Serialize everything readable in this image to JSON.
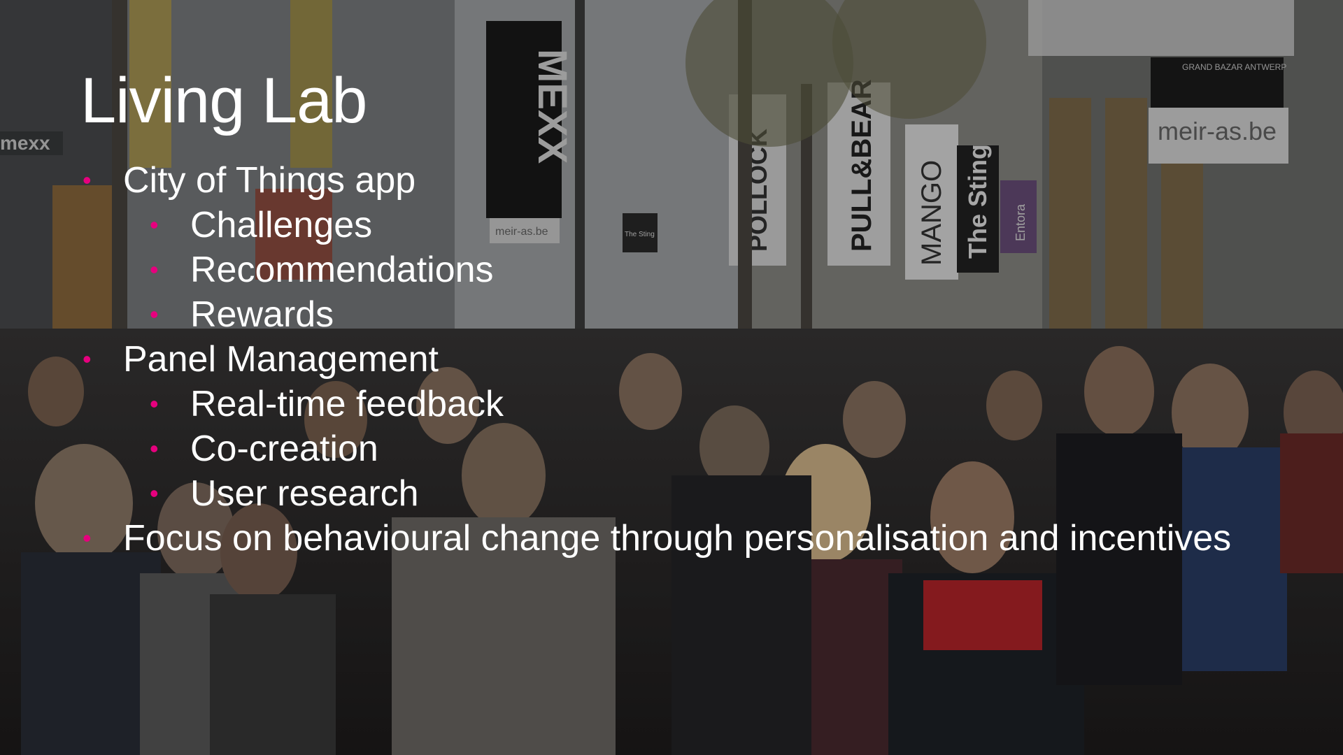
{
  "slide": {
    "title": "Living Lab",
    "bullet_glyph": "•",
    "bullet_color": "#e6007e",
    "items": [
      {
        "level": 1,
        "text": "City of Things app"
      },
      {
        "level": 2,
        "text": "Challenges"
      },
      {
        "level": 2,
        "text": "Recommendations"
      },
      {
        "level": 2,
        "text": "Rewards"
      },
      {
        "level": 1,
        "text": "Panel Management"
      },
      {
        "level": 2,
        "text": "Real-time feedback"
      },
      {
        "level": 2,
        "text": "Co-creation"
      },
      {
        "level": 2,
        "text": "User research"
      },
      {
        "level": 1,
        "text": "Focus on behavioural change through personalisation and incentives"
      }
    ]
  },
  "background": {
    "signs": [
      "MEXX",
      "mexx",
      "meir-as.be",
      "POLLOCK",
      "PULL&BEAR",
      "MANGO",
      "The Sting",
      "GRAND BAZAR ANTWERP",
      "Entora",
      "The Sting",
      "meir-as.be"
    ]
  }
}
